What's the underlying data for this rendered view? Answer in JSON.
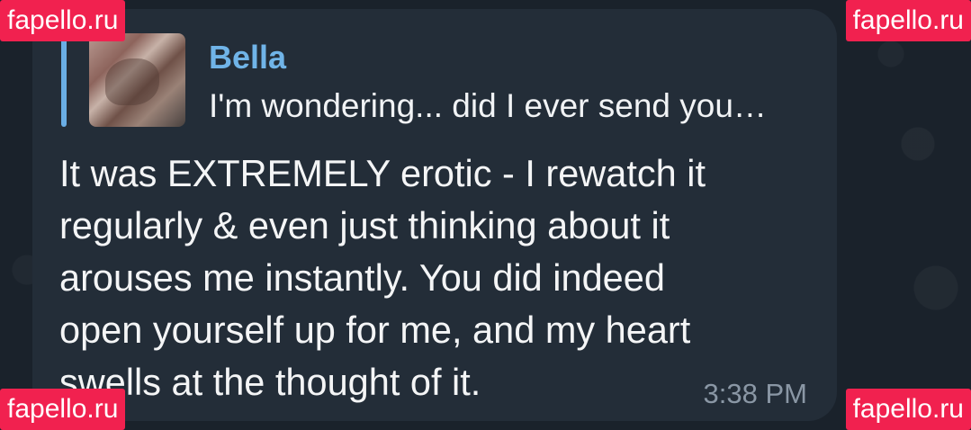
{
  "reply": {
    "name": "Bella",
    "preview": "I'm wondering... did I ever send you…"
  },
  "message": {
    "text": "It was EXTREMELY erotic - I rewatch it\nregularly & even just thinking about it\narouses me instantly. You did indeed\nopen yourself up for me, and my heart\nswells at the thought of it.",
    "time": "3:38 PM"
  },
  "watermarks": {
    "top_left": "fapello.ru",
    "top_right": "fapello.ru",
    "bottom_left": "fapello.ru",
    "bottom_right": "fapello.ru"
  },
  "colors": {
    "background": "#1b232c",
    "bubble": "#232d38",
    "accent": "#6aaee5",
    "watermark": "#f1214f"
  }
}
